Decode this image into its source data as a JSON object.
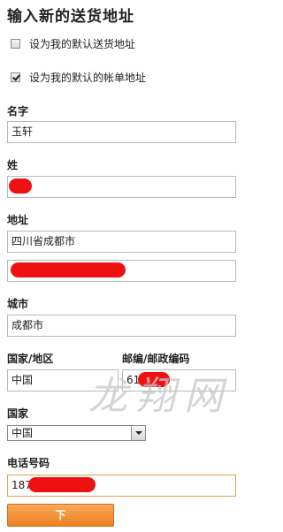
{
  "title": "输入新的送货地址",
  "checkboxes": [
    {
      "label": "设为我的默认送货地址",
      "checked": false
    },
    {
      "label": "设为我的默认的帐单地址",
      "checked": true
    }
  ],
  "name": {
    "label": "名字",
    "value": "玉轩"
  },
  "surname": {
    "label": "姓",
    "value": ""
  },
  "address": {
    "label": "地址",
    "line1": "四川省成都市",
    "line2": ""
  },
  "city": {
    "label": "城市",
    "value": "成都市"
  },
  "region": {
    "label": "国家/地区",
    "value": "中国"
  },
  "postal": {
    "label": "邮编/邮政编码",
    "value": "61"
  },
  "country": {
    "label": "国家",
    "selected": "中国"
  },
  "phone": {
    "label": "电话号码",
    "value": "187"
  },
  "next_button": {
    "label": "下"
  },
  "watermark": "龙翔网",
  "colors": {
    "button": "#ee7f20",
    "redaction": "#ee1111",
    "focus_border": "#e4a14a"
  }
}
